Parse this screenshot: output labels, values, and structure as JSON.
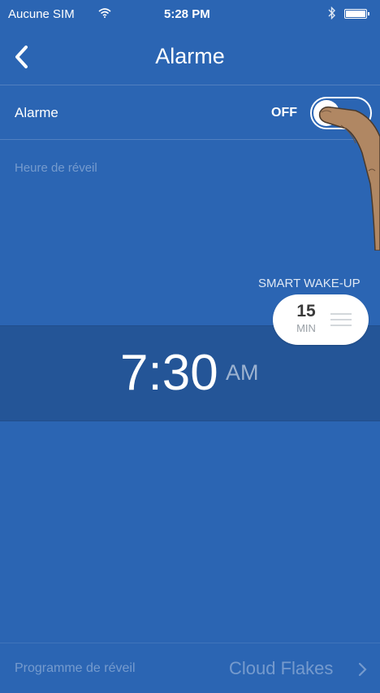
{
  "status_bar": {
    "carrier": "Aucune SIM",
    "wifi_icon": "wifi-icon",
    "time": "5:28 PM",
    "bluetooth_icon": "bluetooth-icon",
    "battery_icon": "battery-icon"
  },
  "nav": {
    "title": "Alarme",
    "back_icon": "chevron-left-icon"
  },
  "alarm_row": {
    "label": "Alarme",
    "state_text": "OFF",
    "enabled": false
  },
  "wake_time_section": {
    "label": "Heure de réveil"
  },
  "smart_wakeup": {
    "label": "SMART WAKE-UP",
    "value": "15",
    "unit": "MIN",
    "menu_icon": "menu-icon"
  },
  "alarm_time": {
    "time": "7:30",
    "ampm": "AM"
  },
  "program_row": {
    "label": "Programme de réveil",
    "value": "Cloud Flakes",
    "chevron_icon": "chevron-right-icon"
  },
  "colors": {
    "background": "#2b65b3",
    "time_band": "#245597",
    "pill": "#ffffff"
  }
}
